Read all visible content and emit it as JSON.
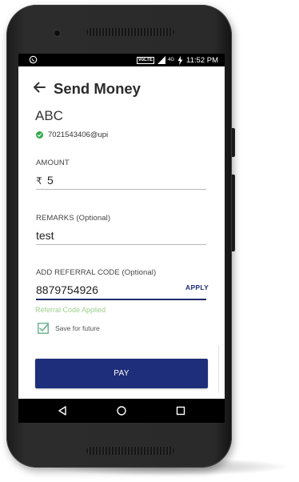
{
  "status_bar": {
    "time": "11:52 PM",
    "network_badge": "VoLTE",
    "network_type": "4G",
    "icons": [
      "whatsapp-icon",
      "signal-icon",
      "battery-charging-icon"
    ]
  },
  "header": {
    "title": "Send Money",
    "back_icon": "back-arrow-icon"
  },
  "payee": {
    "name": "ABC",
    "vpa": "7021543406@upi",
    "verified_icon": "verified-check-icon"
  },
  "form": {
    "amount": {
      "label": "AMOUNT",
      "currency_symbol": "₹",
      "value": "5"
    },
    "remarks": {
      "label": "REMARKS (Optional)",
      "value": "test"
    },
    "referral": {
      "label": "ADD REFERRAL CODE (Optional)",
      "value": "8879754926",
      "apply_label": "APPLY",
      "status_message": "Referral Code Applied"
    },
    "save_for_future": {
      "label": "Save for future",
      "checked": true
    }
  },
  "actions": {
    "pay_label": "PAY"
  },
  "colors": {
    "primary": "#1f2e7a",
    "success_text": "#9ccf8c",
    "verified": "#2ea84a",
    "checkbox": "#6bb08f"
  },
  "nav_bar": {
    "icons": [
      "nav-back-icon",
      "nav-home-icon",
      "nav-recents-icon"
    ]
  }
}
